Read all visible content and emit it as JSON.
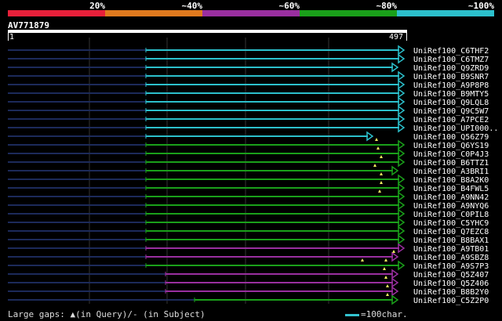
{
  "scale_legend": [
    {
      "label": "20%",
      "color": "#e8203a"
    },
    {
      "label": "~40%",
      "color": "#e07a1e"
    },
    {
      "label": "~60%",
      "color": "#9a2fa0"
    },
    {
      "label": "~80%",
      "color": "#1aa01a"
    },
    {
      "label": "~100%",
      "color": "#2cc0cc"
    }
  ],
  "query": {
    "name": "AV771879",
    "start": "1",
    "end": "497"
  },
  "hits": [
    {
      "label": "UniRef100_C6THF2",
      "color": "#2cc0cc"
    },
    {
      "label": "UniRef100_C6TMZ7",
      "color": "#2cc0cc"
    },
    {
      "label": "UniRef100_Q9ZRD9",
      "color": "#2cc0cc"
    },
    {
      "label": "UniRef100_B9SNR7",
      "color": "#2cc0cc"
    },
    {
      "label": "UniRef100_A9P8P8",
      "color": "#2cc0cc"
    },
    {
      "label": "UniRef100_B9MTY5",
      "color": "#2cc0cc"
    },
    {
      "label": "UniRef100_Q9LQL8",
      "color": "#2cc0cc"
    },
    {
      "label": "UniRef100_Q9C5W7",
      "color": "#2cc0cc"
    },
    {
      "label": "UniRef100_A7PCE2",
      "color": "#2cc0cc"
    },
    {
      "label": "UniRef100_UPI000..",
      "color": "#2cc0cc"
    },
    {
      "label": "UniRef100_Q56Z79",
      "color": "#2cc0cc"
    },
    {
      "label": "UniRef100_Q6YS19",
      "color": "#1aa01a"
    },
    {
      "label": "UniRef100_C0P4J3",
      "color": "#1aa01a"
    },
    {
      "label": "UniRef100_B6TTZ1",
      "color": "#1aa01a"
    },
    {
      "label": "UniRef100_A3BRI1",
      "color": "#1aa01a"
    },
    {
      "label": "UniRef100_B8A2K0",
      "color": "#1aa01a"
    },
    {
      "label": "UniRef100_B4FWL5",
      "color": "#1aa01a"
    },
    {
      "label": "UniRef100_A9NN42",
      "color": "#1aa01a"
    },
    {
      "label": "UniRef100_A9NYQ6",
      "color": "#1aa01a"
    },
    {
      "label": "UniRef100_C0PIL8",
      "color": "#1aa01a"
    },
    {
      "label": "UniRef100_C5YHC9",
      "color": "#1aa01a"
    },
    {
      "label": "UniRef100_Q7EZC8",
      "color": "#1aa01a"
    },
    {
      "label": "UniRef100_B8BAX1",
      "color": "#1aa01a"
    },
    {
      "label": "UniRef100_A9TB01",
      "color": "#9a2fa0"
    },
    {
      "label": "UniRef100_A9SBZ8",
      "color": "#9a2fa0"
    },
    {
      "label": "UniRef100_A9S7P3",
      "color": "#1aa01a"
    },
    {
      "label": "UniRef100_Q5Z407",
      "color": "#9a2fa0"
    },
    {
      "label": "UniRef100_Q5Z406",
      "color": "#9a2fa0"
    },
    {
      "label": "UniRef100_B8B2Y0",
      "color": "#9a2fa0"
    },
    {
      "label": "UniRef100_C5Z2P0",
      "color": "#1aa01a"
    }
  ],
  "footer": {
    "gaps_text": "Large gaps: ▲(in Query)/- (in Subject)",
    "scale_text": "=100char."
  }
}
